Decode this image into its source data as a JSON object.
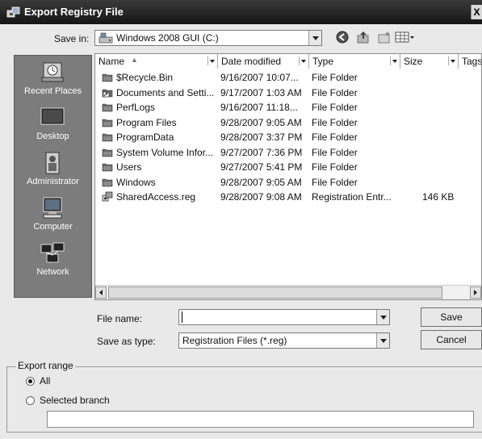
{
  "window": {
    "title": "Export Registry File",
    "close_glyph": "X"
  },
  "toolbar": {
    "save_in_label": "Save in:",
    "location": "Windows 2008 GUI (C:)",
    "icons": [
      "back-icon",
      "up-folder-icon",
      "new-folder-icon",
      "views-menu-icon"
    ]
  },
  "places": [
    {
      "label": "Recent Places",
      "icon": "recent-places-icon"
    },
    {
      "label": "Desktop",
      "icon": "desktop-icon"
    },
    {
      "label": "Administrator",
      "icon": "user-folder-icon"
    },
    {
      "label": "Computer",
      "icon": "computer-icon"
    },
    {
      "label": "Network",
      "icon": "network-icon"
    }
  ],
  "columns": {
    "name": "Name",
    "date": "Date modified",
    "type": "Type",
    "size": "Size",
    "tags": "Tags"
  },
  "files": [
    {
      "name": "$Recycle.Bin",
      "date": "9/16/2007 10:07...",
      "type": "File Folder",
      "size": "",
      "icon": "folder-icon"
    },
    {
      "name": "Documents and Setti...",
      "date": "9/17/2007 1:03 AM",
      "type": "File Folder",
      "size": "",
      "icon": "shortcut-folder-icon"
    },
    {
      "name": "PerfLogs",
      "date": "9/16/2007 11:18...",
      "type": "File Folder",
      "size": "",
      "icon": "folder-icon"
    },
    {
      "name": "Program Files",
      "date": "9/28/2007 9:05 AM",
      "type": "File Folder",
      "size": "",
      "icon": "folder-icon"
    },
    {
      "name": "ProgramData",
      "date": "9/28/2007 3:37 PM",
      "type": "File Folder",
      "size": "",
      "icon": "folder-icon"
    },
    {
      "name": "System Volume Infor...",
      "date": "9/27/2007 7:36 PM",
      "type": "File Folder",
      "size": "",
      "icon": "folder-icon"
    },
    {
      "name": "Users",
      "date": "9/27/2007 5:41 PM",
      "type": "File Folder",
      "size": "",
      "icon": "folder-icon"
    },
    {
      "name": "Windows",
      "date": "9/28/2007 9:05 AM",
      "type": "File Folder",
      "size": "",
      "icon": "folder-icon"
    },
    {
      "name": "SharedAccess.reg",
      "date": "9/28/2007 9:08 AM",
      "type": "Registration Entr...",
      "size": "146 KB",
      "icon": "registry-file-icon"
    }
  ],
  "form": {
    "file_name_label": "File name:",
    "file_name_value": "",
    "save_as_type_label": "Save as type:",
    "save_as_type_value": "Registration Files (*.reg)",
    "save_button": "Save",
    "cancel_button": "Cancel"
  },
  "export_range": {
    "title": "Export range",
    "all_label": "All",
    "branch_label": "Selected branch",
    "selected": "All",
    "branch_value": ""
  }
}
